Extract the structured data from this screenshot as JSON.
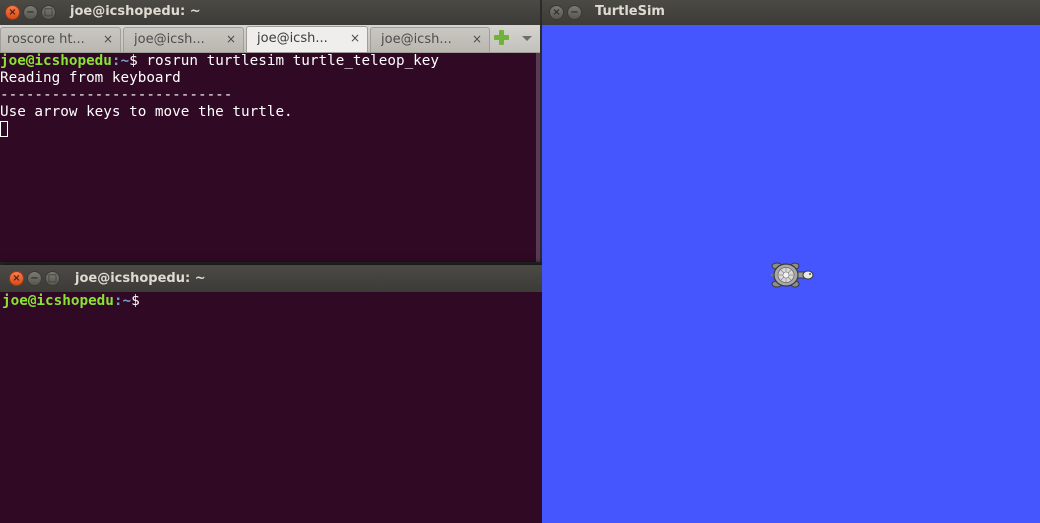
{
  "terminal_top": {
    "title": "joe@icshopedu: ~",
    "tabs": [
      {
        "label": "roscore ht...",
        "active": false
      },
      {
        "label": "joe@icsh...",
        "active": false
      },
      {
        "label": "joe@icsh...",
        "active": true
      },
      {
        "label": "joe@icsh...",
        "active": false
      }
    ],
    "close_glyph": "×",
    "new_tab_icon": "plus-icon",
    "tab_menu_icon": "dropdown-icon",
    "prompt_user": "joe@icshopedu",
    "prompt_path": ":~",
    "prompt_sym": "$ ",
    "command": "rosrun turtlesim turtle_teleop_key",
    "output": [
      "Reading from keyboard",
      "---------------------------",
      "Use arrow keys to move the turtle."
    ]
  },
  "terminal_bottom": {
    "title": "joe@icshopedu: ~",
    "prompt_user": "joe@icshopedu",
    "prompt_path": ":~",
    "prompt_sym": "$"
  },
  "turtlesim": {
    "title": "TurtleSim",
    "background_color": "#4556ff"
  },
  "window_controls": {
    "close": "×",
    "minimize": "−",
    "maximize": "□"
  }
}
